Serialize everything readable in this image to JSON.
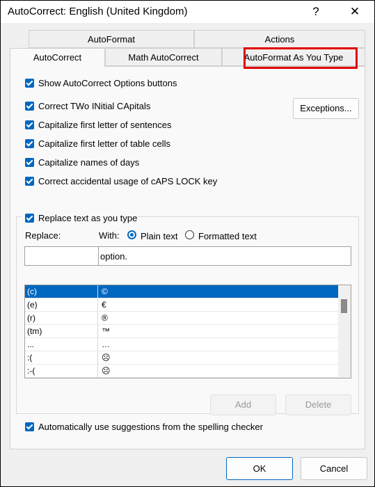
{
  "window": {
    "title": "AutoCorrect: English (United Kingdom)",
    "help_glyph": "?",
    "close_glyph": "✕"
  },
  "tabs": {
    "row1": [
      "AutoFormat",
      "Actions"
    ],
    "row2": [
      "AutoCorrect",
      "Math AutoCorrect",
      "AutoFormat As You Type"
    ]
  },
  "options": {
    "show_options": "Show AutoCorrect Options buttons",
    "correct_two_initial": "Correct TWo INitial CApitals",
    "cap_sentences": "Capitalize first letter of sentences",
    "cap_table_cells": "Capitalize first letter of table cells",
    "cap_days": "Capitalize names of days",
    "caps_lock": "Correct accidental usage of cAPS LOCK key",
    "exceptions_button": "Exceptions...",
    "replace_as_you_type": "Replace text as you type"
  },
  "replace_group": {
    "replace_label": "Replace:",
    "with_label": "With:",
    "plain_text": "Plain text",
    "formatted_text": "Formatted text",
    "selected_format": "Plain text",
    "replace_value": "",
    "with_value": "option."
  },
  "entries": [
    {
      "from": "(c)",
      "to": "©"
    },
    {
      "from": "(e)",
      "to": "€"
    },
    {
      "from": "(r)",
      "to": "®"
    },
    {
      "from": "(tm)",
      "to": "™"
    },
    {
      "from": "...",
      "to": "…"
    },
    {
      "from": ":(",
      "to": "☹"
    },
    {
      "from": ":-(",
      "to": "☹"
    }
  ],
  "selected_entry": "(c)",
  "buttons": {
    "add": "Add",
    "delete": "Delete",
    "spelling": "Automatically use suggestions from the spelling checker",
    "ok": "OK",
    "cancel": "Cancel"
  },
  "colors": {
    "accent": "#0067c0",
    "highlight_box": "#e00000"
  }
}
